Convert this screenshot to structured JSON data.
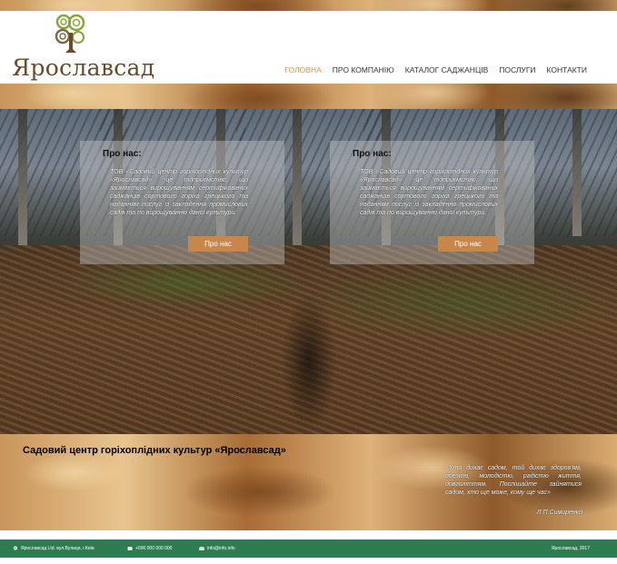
{
  "brand": {
    "name": "Ярославсад"
  },
  "nav": {
    "items": [
      {
        "label": "ГОЛОВНА",
        "active": true
      },
      {
        "label": "ПРО КОМПАНІЮ",
        "active": false
      },
      {
        "label": "КАТАЛОГ САДЖАНЦІВ",
        "active": false
      },
      {
        "label": "ПОСЛУГИ",
        "active": false
      },
      {
        "label": "КОНТАКТИ",
        "active": false
      }
    ]
  },
  "cards": [
    {
      "title": "Про нас:",
      "text": "ТОВ «Садовий центр горіхоплідних культур «Ярославсад» -це підприємство, що займається вирощуванням сертифікованих саджанців сортового горіха грецького та наданням послуг із закладення промислових садів та по вирощуванню даної культури.",
      "button": "Про нас"
    },
    {
      "title": "Про нас:",
      "text": "ТОВ «Садовий центр горіхоплідних культур «Ярославсад» -це підприємство, що займається вирощуванням сертифікованих саджанців сортового горіха грецького та наданням послуг із закладення промислових садів та по вирощуванню даної культури.",
      "button": "Про нас"
    }
  ],
  "quote_band": {
    "company": "Садовий центр горіхоплідних культур «Ярославсад»",
    "quote": "«Хто дихає садом, той дихає здоров'ям, поезією, молодістю, радістю життя, довголіттям. Поспішайте зайнятися садом, хто ще може, кому ще час»",
    "author": "Л.П.Симиренко"
  },
  "footer": {
    "address": "Ярославсад Ltd. вул.Вулиця, г.Київ",
    "phone": "+000 000 000 000",
    "email": "info@info.info",
    "copyright": "Ярославсад, 2017"
  },
  "colors": {
    "accent": "#c8874a",
    "nav_active": "#d8964a",
    "footer": "#2e7d52",
    "logo_text": "#6b4a2a"
  },
  "icons": {
    "logo": "tree-logo-icon",
    "address": "location-icon",
    "phone": "phone-icon",
    "email": "mail-icon"
  }
}
